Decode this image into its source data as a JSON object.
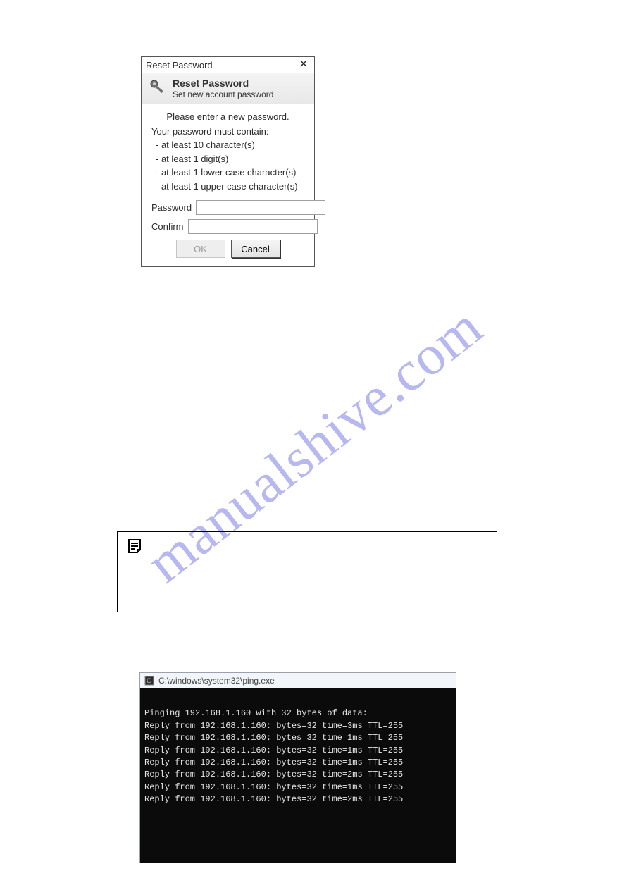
{
  "watermark": "manualshive.com",
  "dialog": {
    "window_title": "Reset Password",
    "header_title": "Reset Password",
    "header_subtitle": "Set new account password",
    "prompt": "Please enter a new password.",
    "requirements_header": "Your password must contain:",
    "requirements": [
      "- at least 10 character(s)",
      "- at least 1 digit(s)",
      "- at least 1 lower case character(s)",
      "- at least 1 upper case character(s)"
    ],
    "password_label": "Password",
    "confirm_label": "Confirm",
    "password_value": "",
    "confirm_value": "",
    "ok_label": "OK",
    "cancel_label": "Cancel"
  },
  "terminal": {
    "title": "C:\\windows\\system32\\ping.exe",
    "lines": [
      "",
      "Pinging 192.168.1.160 with 32 bytes of data:",
      "Reply from 192.168.1.160: bytes=32 time=3ms TTL=255",
      "Reply from 192.168.1.160: bytes=32 time=1ms TTL=255",
      "Reply from 192.168.1.160: bytes=32 time=1ms TTL=255",
      "Reply from 192.168.1.160: bytes=32 time=1ms TTL=255",
      "Reply from 192.168.1.160: bytes=32 time=2ms TTL=255",
      "Reply from 192.168.1.160: bytes=32 time=1ms TTL=255",
      "Reply from 192.168.1.160: bytes=32 time=2ms TTL=255"
    ]
  }
}
